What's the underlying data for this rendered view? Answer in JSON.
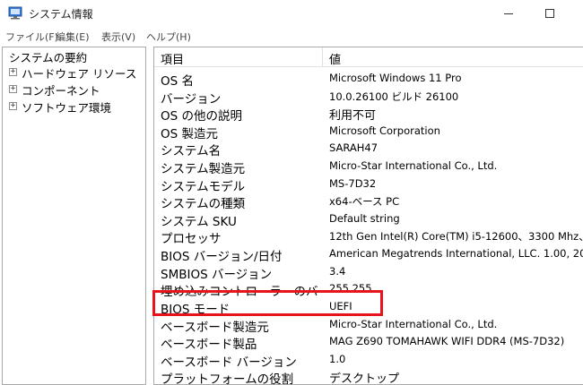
{
  "window": {
    "title": "システム情報"
  },
  "menu": [
    "ファイル(F)",
    "編集(E)",
    "表示(V)",
    "ヘルプ(H)"
  ],
  "tree": {
    "root": "システムの要約",
    "items": [
      {
        "label": "ハードウェア リソース",
        "expander": "+"
      },
      {
        "label": "コンポーネント",
        "expander": "+"
      },
      {
        "label": "ソフトウェア環境",
        "expander": "+"
      }
    ]
  },
  "table": {
    "headers": {
      "item": "項目",
      "value": "値"
    },
    "rows": [
      {
        "name": "OS 名",
        "value": "Microsoft Windows 11 Pro"
      },
      {
        "name": "バージョン",
        "value": "10.0.26100 ビルド 26100"
      },
      {
        "name": "OS の他の説明",
        "value": "利用不可"
      },
      {
        "name": "OS 製造元",
        "value": "Microsoft Corporation"
      },
      {
        "name": "システム名",
        "value": "SARAH47"
      },
      {
        "name": "システム製造元",
        "value": "Micro-Star International Co., Ltd."
      },
      {
        "name": "システムモデル",
        "value": "MS-7D32"
      },
      {
        "name": "システムの種類",
        "value": "x64-ベース PC"
      },
      {
        "name": "システム SKU",
        "value": "Default string"
      },
      {
        "name": "プロセッサ",
        "value": "12th Gen Intel(R) Core(TM) i5-12600、3300 Mhz、6"
      },
      {
        "name": "BIOS バージョン/日付",
        "value": "American Megatrends International, LLC. 1.00, 2021/"
      },
      {
        "name": "SMBIOS バージョン",
        "value": "3.4"
      },
      {
        "name": "埋め込みコントローラーのバー",
        "value": "255.255"
      },
      {
        "name": "BIOS モード",
        "value": "UEFI"
      },
      {
        "name": "ベースボード製造元",
        "value": "Micro-Star International Co., Ltd."
      },
      {
        "name": "ベースボード製品",
        "value": "MAG Z690 TOMAHAWK WIFI DDR4 (MS-7D32)"
      },
      {
        "name": "ベースボード バージョン",
        "value": "1.0"
      },
      {
        "name": "プラットフォームの役割",
        "value": "デスクトップ"
      }
    ]
  },
  "highlight": {
    "row": "BIOS モード",
    "color": "#e8141c"
  },
  "icons": {
    "app": "system-info-icon",
    "minimize": "minimize-icon",
    "maximize": "maximize-icon"
  }
}
